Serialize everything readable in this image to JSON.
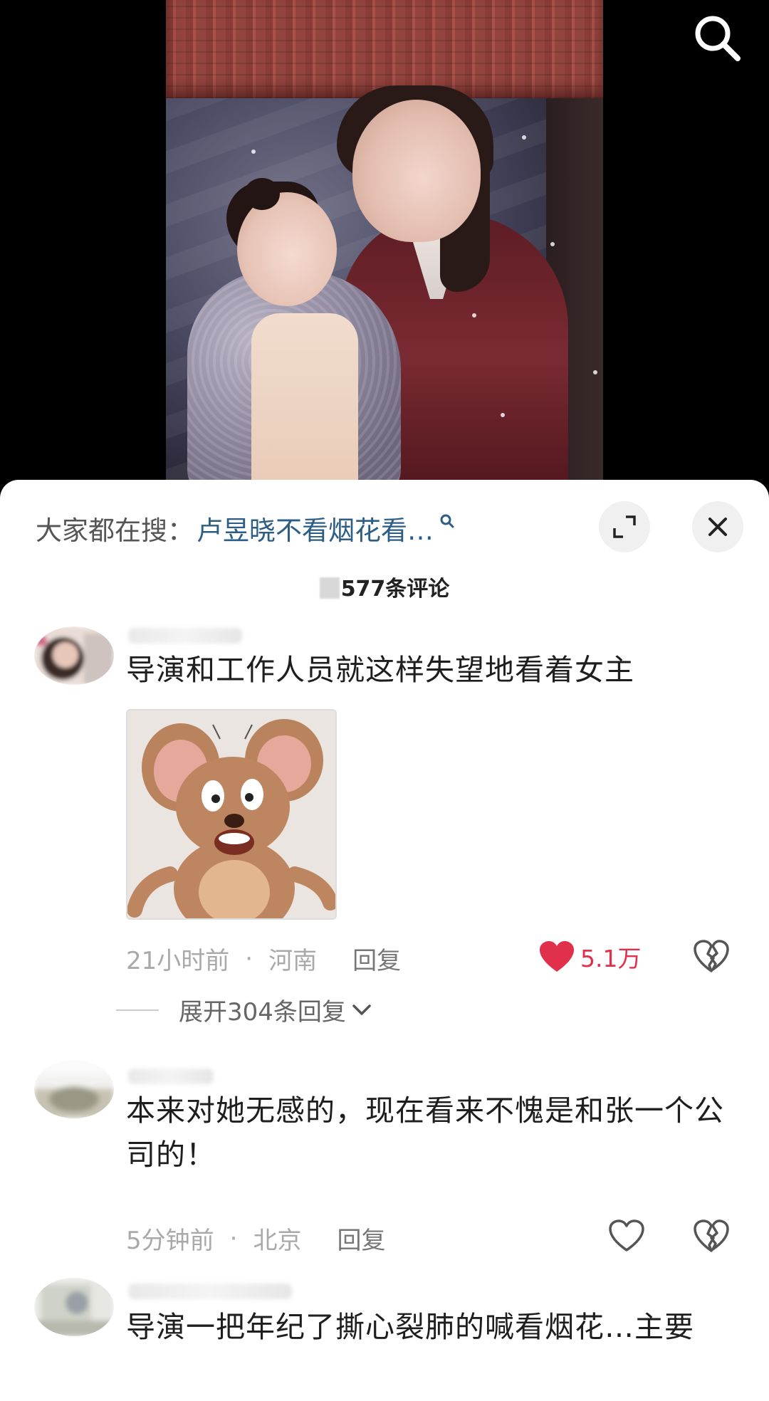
{
  "hot_search": {
    "label": "大家都在搜：",
    "term": "卢昱晓不看烟花看…"
  },
  "comment_count": "577条评论",
  "comments": [
    {
      "text": "导演和工作人员就这样失望地看着女主",
      "time": "21小时前",
      "location": "河南",
      "reply": "回复",
      "likes": "5.1万",
      "liked": true,
      "expand": "展开304条回复"
    },
    {
      "text": "本来对她无感的，现在看来不愧是和张一个公司的！",
      "time": "5分钟前",
      "location": "北京",
      "reply": "回复"
    },
    {
      "text": "导演一把年纪了撕心裂肺的喊看烟花…主要"
    }
  ],
  "colors": {
    "accent_red": "#e0304b",
    "link_blue": "#2b5d86"
  }
}
